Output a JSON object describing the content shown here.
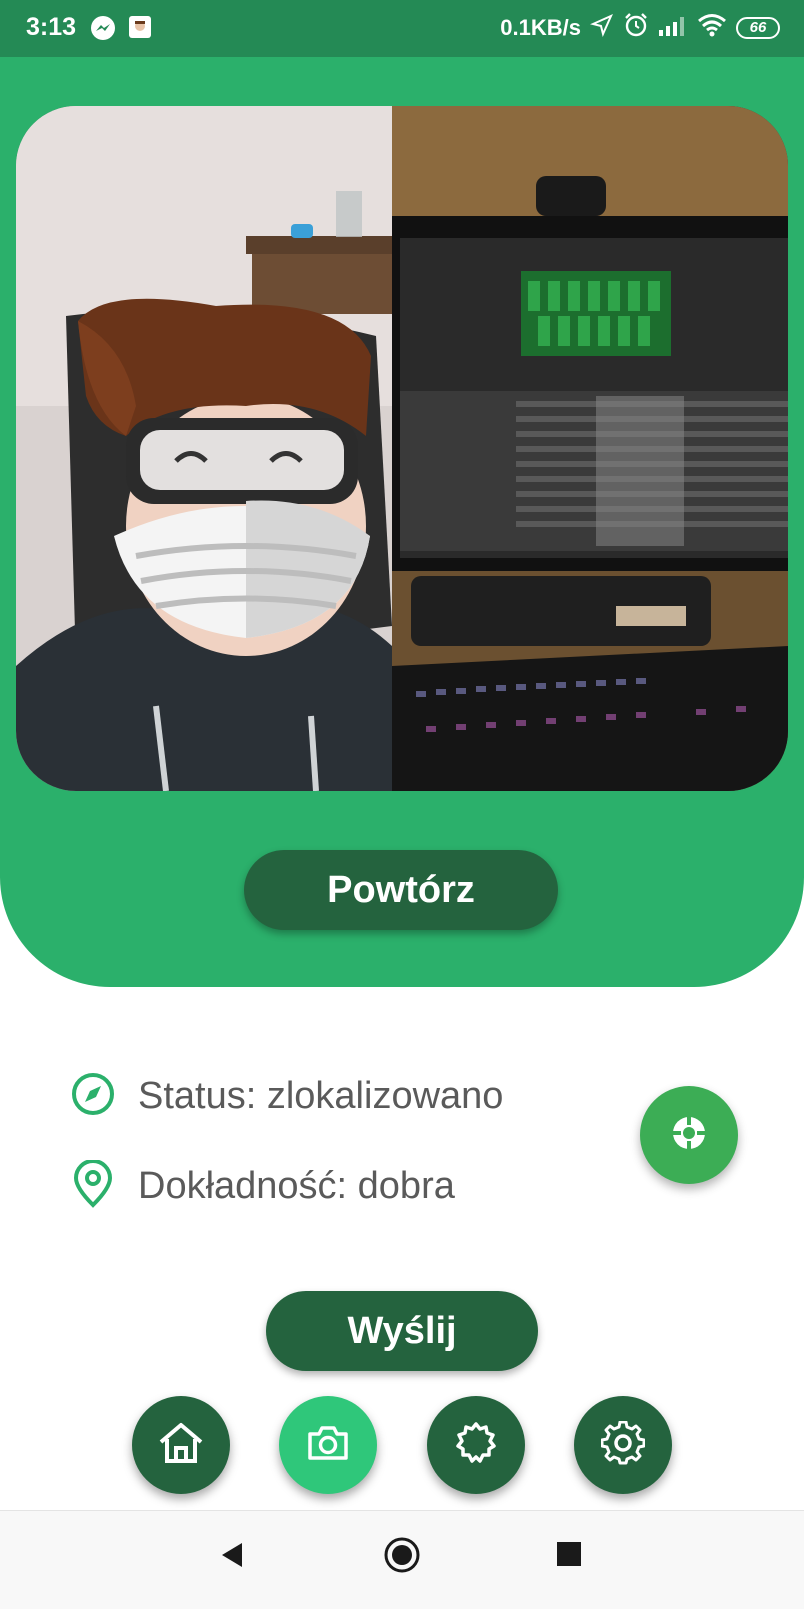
{
  "status_bar": {
    "time": "3:13",
    "net_speed": "0.1KB/s",
    "battery": "66",
    "icons": [
      "messenger-icon",
      "app-avatar-icon",
      "location-arrow-icon",
      "alarm-icon",
      "signal-icon",
      "wifi-icon",
      "battery-icon"
    ]
  },
  "photo": {
    "description_icons": [
      "selfie-with-mask-overlay",
      "rear-camera-monitor"
    ]
  },
  "buttons": {
    "retry_label": "Powtórz",
    "send_label": "Wyślij"
  },
  "location": {
    "status_text": "Status: zlokalizowano",
    "accuracy_text": "Dokładność: dobra"
  },
  "bottom_nav": {
    "items": [
      "home-icon",
      "camera-icon",
      "badge-icon",
      "settings-icon"
    ],
    "active_index": 1
  },
  "colors": {
    "status_bar": "#248a55",
    "header": "#2bb06b",
    "dark_button": "#24633e",
    "active_nav": "#2fc77a",
    "fab": "#3cad55"
  }
}
